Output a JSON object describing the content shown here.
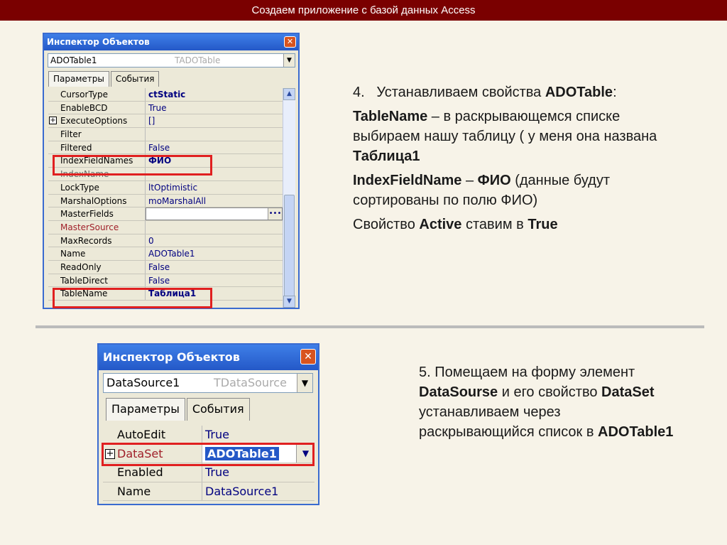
{
  "slide": {
    "title": "Создаем приложение с базой данных Access"
  },
  "inspector1": {
    "title": "Инспектор Объектов",
    "close": "✕",
    "object_name": "ADOTable1",
    "object_type": "TADOTable",
    "tabs": [
      "Параметры",
      "События"
    ],
    "rows": [
      {
        "name": "CursorType",
        "value": "ctStatic"
      },
      {
        "name": "EnableBCD",
        "value": "True"
      },
      {
        "name": "ExecuteOptions",
        "value": "[]"
      },
      {
        "name": "Filter",
        "value": ""
      },
      {
        "name": "Filtered",
        "value": "False"
      },
      {
        "name": "IndexFieldNames",
        "value": "ФИО"
      },
      {
        "name": "IndexName",
        "value": ""
      },
      {
        "name": "LockType",
        "value": "ltOptimistic"
      },
      {
        "name": "MarshalOptions",
        "value": "moMarshalAll"
      },
      {
        "name": "MasterFields",
        "value": ""
      },
      {
        "name": "MasterSource",
        "value": ""
      },
      {
        "name": "MaxRecords",
        "value": "0"
      },
      {
        "name": "Name",
        "value": "ADOTable1"
      },
      {
        "name": "ReadOnly",
        "value": "False"
      },
      {
        "name": "TableDirect",
        "value": "False"
      },
      {
        "name": "TableName",
        "value": "Таблица1"
      }
    ]
  },
  "inspector2": {
    "title": "Инспектор Объектов",
    "close": "✕",
    "object_name": "DataSource1",
    "object_type": "TDataSource",
    "tabs": [
      "Параметры",
      "События"
    ],
    "rows": [
      {
        "name": "AutoEdit",
        "value": "True"
      },
      {
        "name": "DataSet",
        "value": "ADOTable1"
      },
      {
        "name": "Enabled",
        "value": "True"
      },
      {
        "name": "Name",
        "value": "DataSource1"
      }
    ]
  },
  "step4": {
    "number": "4.",
    "intro": "Устанавливаем свойства ",
    "intro_bold": "ADOTable",
    "intro_end": ":",
    "tablename_bold": "TableName",
    "tablename_text": " – в раскрывающемся списке выбираем нашу таблицу ( у меня она названа ",
    "tablename_value": "Таблица1",
    "index_bold": "IndexFieldName",
    "index_dash": " – ",
    "index_value": "ФИО",
    "index_text": " (данные будут сортированы по полю ФИО)",
    "active_text1": "Свойство ",
    "active_bold": "Active",
    "active_text2": " ставим в ",
    "active_value": "True"
  },
  "step5": {
    "number": "5.",
    "text1": " Помещаем на форму элемент ",
    "bold1": "DataSourse",
    "text2": " и его свойство ",
    "bold2": "DataSet",
    "text3": " устанавливаем через раскрывающийся список в ",
    "bold3": "ADOTable1"
  }
}
